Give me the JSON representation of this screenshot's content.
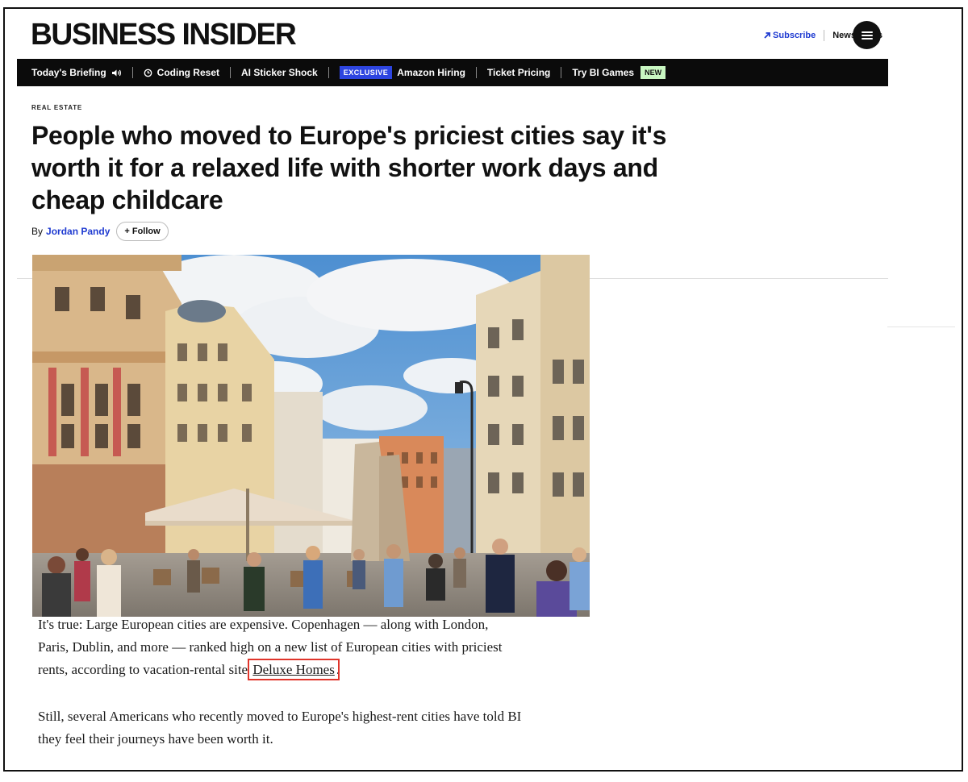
{
  "header": {
    "logo": "BUSINESS INSIDER",
    "subscribe_label": "Subscribe",
    "newsletters_label": "Newsletters"
  },
  "nav": {
    "items": [
      {
        "label": "Today's Briefing"
      },
      {
        "label": "Coding Reset"
      },
      {
        "label": "AI Sticker Shock"
      },
      {
        "label": "Amazon Hiring",
        "badge": "EXCLUSIVE"
      },
      {
        "label": "Ticket Pricing"
      },
      {
        "label": "Try BI Games",
        "badge": "NEW"
      }
    ]
  },
  "article": {
    "category": "REAL ESTATE",
    "headline": "People who moved to Europe's priciest cities say it's worth it for a relaxed life with shorter work days and cheap childcare",
    "byline_prefix": "By",
    "author": "Jordan Pandy",
    "follow_label": "+ Follow",
    "paragraph1_text": "It's true: Large European cities are expensive. Copenhagen — along with London, Paris, Dublin, and more — ranked high on a new list of European cities with priciest rents, according to vacation-rental site",
    "paragraph1_link": "Deluxe Homes",
    "paragraph1_end": ".",
    "paragraph2": "Still, several Americans who recently moved to Europe's highest-rent cities have told BI they feel their journeys have been worth it."
  },
  "colors": {
    "accent_blue": "#1f3bd1",
    "navbar_bg": "#0b0b0b",
    "exclusive_badge": "#2d45e0",
    "new_badge": "#c9f7c2",
    "highlight_box": "#e0352b"
  },
  "icons": [
    "arrow-up-right-icon",
    "speaker-icon",
    "reset-icon",
    "hamburger-menu-icon"
  ]
}
